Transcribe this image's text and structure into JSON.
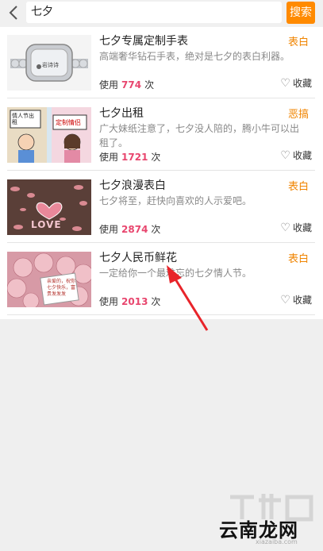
{
  "search": {
    "query": "七夕",
    "button_label": "搜索"
  },
  "items": [
    {
      "title": "七夕专属定制手表",
      "tag": "表白",
      "desc": "高端奢华钻石手表，绝对是七夕的表白利器。",
      "usage_prefix": "使用",
      "usage_count": "774",
      "usage_suffix": "次",
      "fav_label": "收藏",
      "thumb_text": "岩诗诗"
    },
    {
      "title": "七夕出租",
      "tag": "恶搞",
      "desc": "广大妹纸注意了，七夕没人陪的，腾小牛可以出租了。",
      "usage_prefix": "使用",
      "usage_count": "1721",
      "usage_suffix": "次",
      "fav_label": "收藏",
      "thumb_text_a": "情人节出租",
      "thumb_text_b": "定制情侣"
    },
    {
      "title": "七夕浪漫表白",
      "tag": "表白",
      "desc": "七夕将至，赶快向喜欢的人示爱吧。",
      "usage_prefix": "使用",
      "usage_count": "2874",
      "usage_suffix": "次",
      "fav_label": "收藏",
      "thumb_text": "LOVE"
    },
    {
      "title": "七夕人民币鲜花",
      "tag": "表白",
      "desc": "一定给你一个最难忘的七夕情人节。",
      "usage_prefix": "使用",
      "usage_count": "2013",
      "usage_suffix": "次",
      "fav_label": "收藏",
      "thumb_text": "亲爱的，祝你七夕快乐，富贵发发发"
    }
  ],
  "watermark": {
    "text": "云南龙网",
    "subtext": "xiazaiba.com"
  },
  "colors": {
    "accent": "#ff8a00",
    "tag": "#f08400",
    "count": "#e8466e"
  }
}
